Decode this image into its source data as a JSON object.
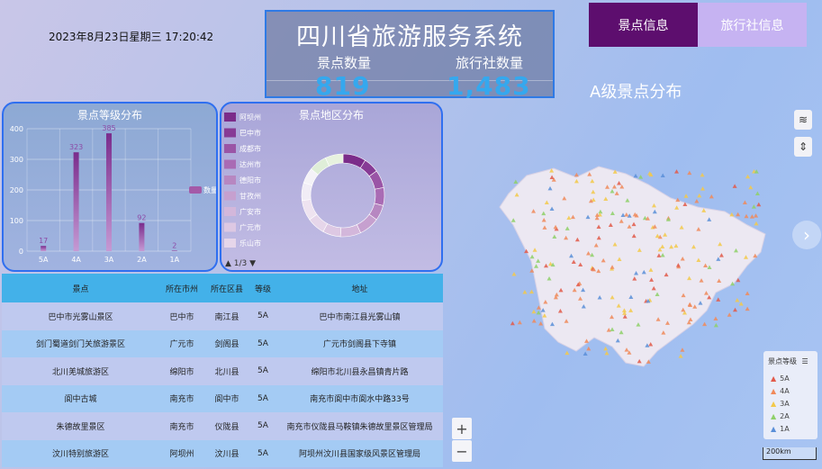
{
  "datetime": "2023年8月23日星期三 17:20:42",
  "header": {
    "title": "四川省旅游服务系统",
    "spots_label": "景点数量",
    "spots_value": "819",
    "agencies_label": "旅行社数量",
    "agencies_value": "1,483"
  },
  "tabs": {
    "active": "景点信息",
    "inactive": "旅行社信息"
  },
  "map": {
    "title": "A级景点分布",
    "scale": "200km",
    "legend_title": "景点等级",
    "legend": [
      {
        "label": "5A",
        "color": "#e25a4a"
      },
      {
        "label": "4A",
        "color": "#f08a5a"
      },
      {
        "label": "3A",
        "color": "#f3c94a"
      },
      {
        "label": "2A",
        "color": "#8fd06a"
      },
      {
        "label": "1A",
        "color": "#5a8fd8"
      }
    ]
  },
  "chart_data": [
    {
      "type": "bar",
      "title": "景点等级分布",
      "categories": [
        "5A",
        "4A",
        "3A",
        "2A",
        "1A"
      ],
      "series": [
        {
          "name": "数量",
          "values": [
            17,
            323,
            385,
            92,
            2
          ]
        }
      ],
      "ylim": [
        0,
        400
      ],
      "yticks": [
        0,
        100,
        200,
        300,
        400
      ],
      "legend": "right",
      "grid": true
    },
    {
      "type": "pie",
      "title": "景点地区分布",
      "labels": [
        "阿坝州",
        "巴中市",
        "成都市",
        "达州市",
        "德阳市",
        "甘孜州",
        "广安市",
        "广元市",
        "乐山市"
      ],
      "colors": [
        "#7b2c8a",
        "#873b95",
        "#9a55a6",
        "#a96bb4",
        "#b787c1",
        "#c6a0cf",
        "#d3b7db",
        "#ddc8e3",
        "#e6d6ea"
      ],
      "legend": "left",
      "pager": "1/3"
    }
  ],
  "table": {
    "headers": [
      "景点",
      "所在市州",
      "所在区县",
      "等级",
      "地址"
    ],
    "rows": [
      [
        "巴中市光雾山景区",
        "巴中市",
        "南江县",
        "5A",
        "巴中市南江县光雾山镇"
      ],
      [
        "剑门蜀道剑门关旅游景区",
        "广元市",
        "剑阁县",
        "5A",
        "广元市剑阁县下寺镇"
      ],
      [
        "北川羌城旅游区",
        "绵阳市",
        "北川县",
        "5A",
        "绵阳市北川县永昌镇青片路"
      ],
      [
        "阆中古城",
        "南充市",
        "阆中市",
        "5A",
        "南充市阆中市阆水中路33号"
      ],
      [
        "朱德故里景区",
        "南充市",
        "仪陇县",
        "5A",
        "南充市仪陇县马鞍镇朱德故里景区管理局"
      ],
      [
        "汶川特别旅游区",
        "阿坝州",
        "汶川县",
        "5A",
        "阿坝州汶川县国家级风景区管理局"
      ]
    ]
  }
}
